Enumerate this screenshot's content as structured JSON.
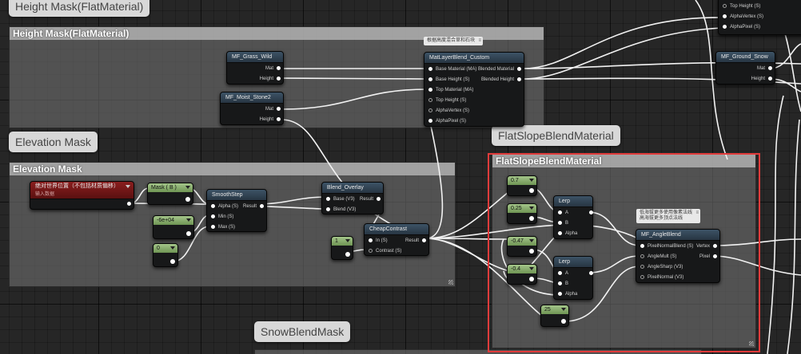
{
  "colors": {
    "selection": "#e23b3b",
    "constant_header": "#8db570",
    "node_header": "#31475a",
    "error_header": "#7a1a1a"
  },
  "height_mask": {
    "bubble": "Height Mask(FlatMaterial)",
    "title": "Height Mask(FlatMaterial)",
    "grass": {
      "title": "MF_Grass_Wild",
      "out1": "Mat",
      "out2": "Height"
    },
    "stone": {
      "title": "MF_Moist_Stone2",
      "out1": "Mat",
      "out2": "Height"
    },
    "note": "根据高度混合草和石块",
    "blend": {
      "title": "MatLayerBlend_Custom",
      "in1": "Base Material (MA)",
      "out1": "Blended Material",
      "in2": "Base Height (S)",
      "out2": "Blended Height",
      "in3": "Top Material (MA)",
      "in4": "Top Height (S)",
      "in5": "AlphaVertex (S)",
      "in6": "AlphaPixel (S)"
    }
  },
  "top_right": {
    "pins": [
      "Top Height (S)",
      "AlphaVertex (S)",
      "AlphaPixel (S)"
    ],
    "snow": {
      "title": "MF_Ground_Snow",
      "out1": "Mat",
      "out2": "Height"
    }
  },
  "elevation_mask": {
    "bubble": "Elevation Mask",
    "title": "Elevation Mask",
    "world_pos": {
      "title": "绝对世界位置（不包括材质偏移）",
      "subtitle": "输入数据"
    },
    "mask": "Mask ( B )",
    "const_big": "-6e+04",
    "const_zero": "0",
    "smoothstep": {
      "title": "SmoothStep",
      "in1": "Alpha (S)",
      "out1": "Result",
      "in2": "Min (S)",
      "in3": "Max (S)"
    },
    "overlay": {
      "title": "Blend_Overlay",
      "in1": "Base (V3)",
      "out1": "Result",
      "in2": "Blend (V3)"
    },
    "const_one": "1",
    "cheap": {
      "title": "CheapContrast",
      "in1": "In (S)",
      "out1": "Result",
      "in2": "Contrast (S)"
    }
  },
  "flat_slope": {
    "bubble": "FlatSlopeBlendMaterial",
    "title": "FlatSlopeBlendMaterial",
    "c1": "0.7",
    "c2": "0.25",
    "c3": "-0.47",
    "c4": "-0.4",
    "c5": "25",
    "lerp1": {
      "title": "Lerp",
      "a": "A",
      "b": "B",
      "alpha": "Alpha"
    },
    "lerp2": {
      "title": "Lerp",
      "a": "A",
      "b": "B",
      "alpha": "Alpha"
    },
    "note_line1": "低海拔更多使用像素法线",
    "note_line2": "高海拔更多顶点法线",
    "angle": {
      "title": "MF_AngleBlend",
      "in1": "PixelNormalBlend (S)",
      "out1": "Vertex",
      "in2": "AngleMult (S)",
      "out2": "Pixel",
      "in3": "AngleSharp (V3)",
      "in4": "PixelNormal (V3)"
    }
  },
  "snow_blend": {
    "bubble": "SnowBlendMask"
  }
}
